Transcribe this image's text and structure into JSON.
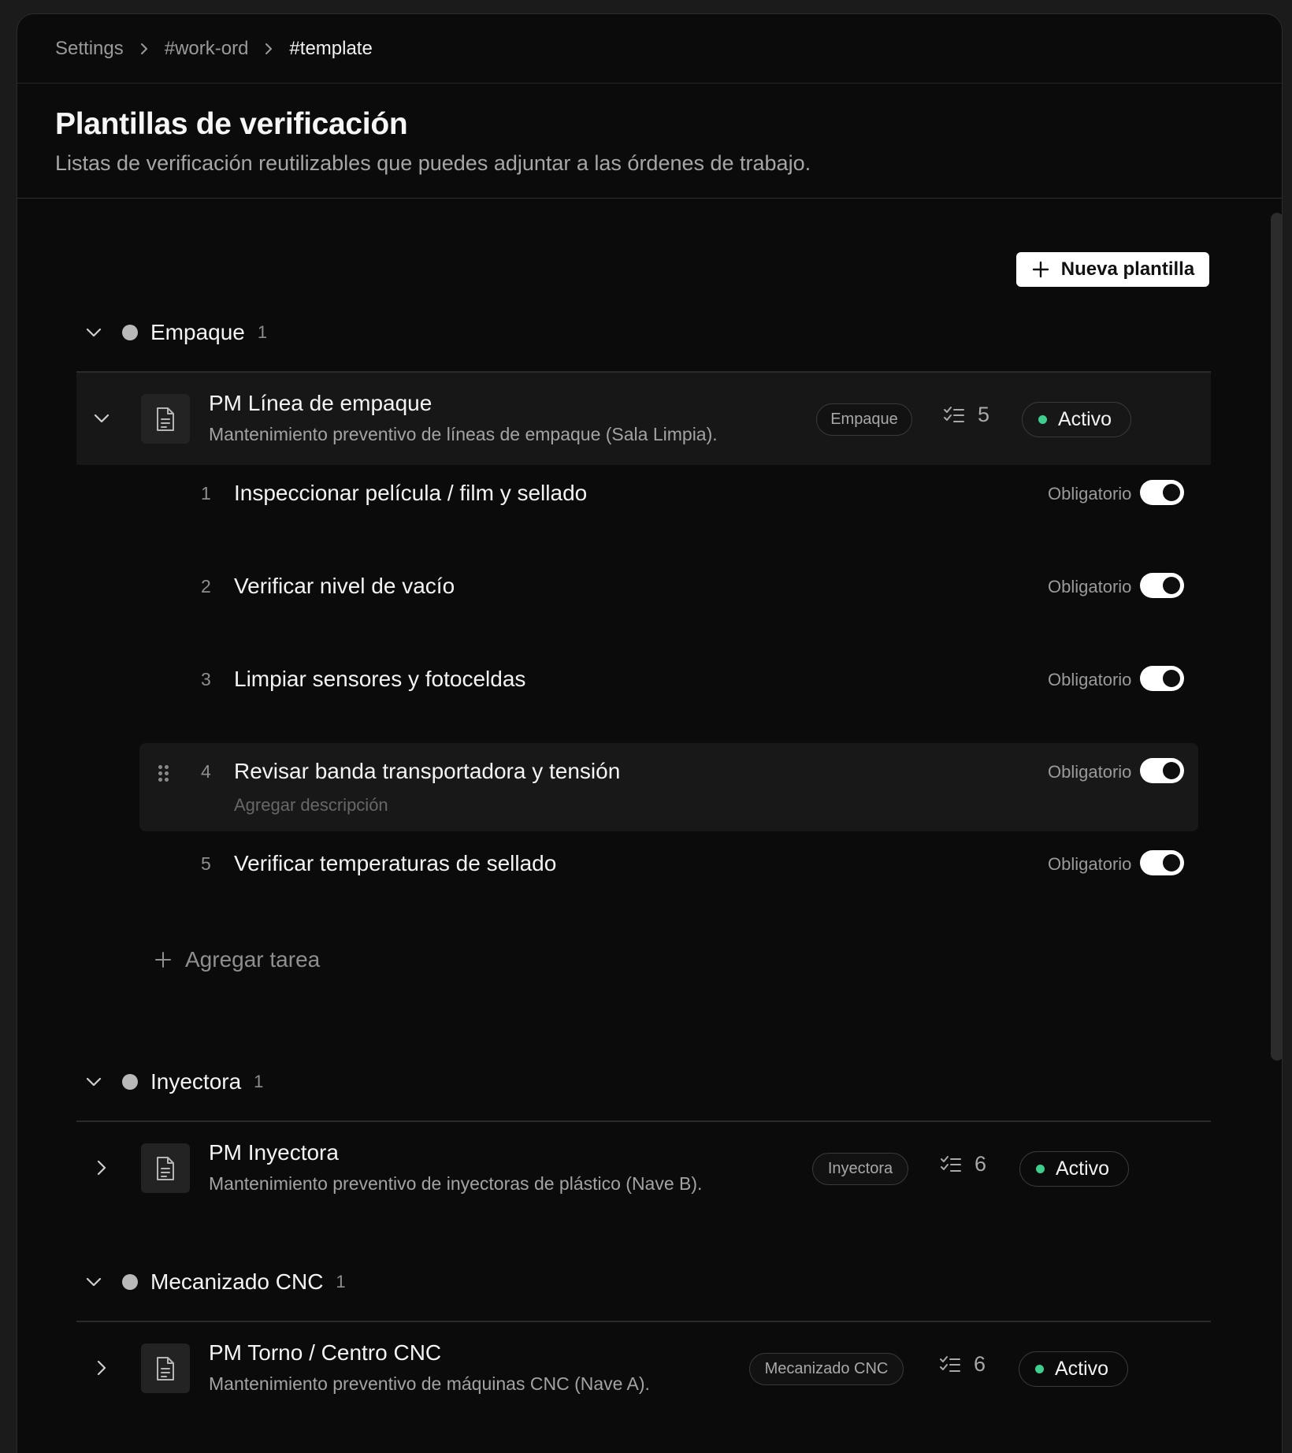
{
  "breadcrumb": [
    "Settings",
    "#work-ord",
    "#template"
  ],
  "page": {
    "title": "Plantillas de verificación",
    "subtitle": "Listas de verificación reutilizables que puedes adjuntar a las órdenes de trabajo."
  },
  "new_template_label": "Nueva plantilla",
  "accent_colors": {
    "status_active": "#3ecf8e",
    "toggle_on": "#ffffff"
  },
  "groups": [
    {
      "name": "Empaque",
      "count": "1",
      "templates": [
        {
          "name": "PM Línea de empaque",
          "description": "Mantenimiento preventivo de líneas de empaque (Sala Limpia).",
          "tag": "Empaque",
          "task_count": "5",
          "status": "Activo",
          "expanded": true,
          "tasks": [
            {
              "num": "1",
              "label": "Inspeccionar película / film y sellado",
              "required_label": "Obligatorio",
              "required": true
            },
            {
              "num": "2",
              "label": "Verificar nivel de vacío",
              "required_label": "Obligatorio",
              "required": true
            },
            {
              "num": "3",
              "label": "Limpiar sensores y fotoceldas",
              "required_label": "Obligatorio",
              "required": true
            },
            {
              "num": "4",
              "label": "Revisar banda transportadora y tensión",
              "description_placeholder": "Agregar descripción",
              "required_label": "Obligatorio",
              "required": true
            },
            {
              "num": "5",
              "label": "Verificar temperaturas de sellado",
              "required_label": "Obligatorio",
              "required": true
            }
          ],
          "add_task_label": "Agregar tarea"
        }
      ]
    },
    {
      "name": "Inyectora",
      "count": "1",
      "templates": [
        {
          "name": "PM Inyectora",
          "description": "Mantenimiento preventivo de inyectoras de plástico (Nave B).",
          "tag": "Inyectora",
          "task_count": "6",
          "status": "Activo",
          "expanded": false
        }
      ]
    },
    {
      "name": "Mecanizado CNC",
      "count": "1",
      "templates": [
        {
          "name": "PM Torno / Centro CNC",
          "description": "Mantenimiento preventivo de máquinas CNC (Nave A).",
          "tag": "Mecanizado CNC",
          "task_count": "6",
          "status": "Activo",
          "expanded": false
        }
      ]
    }
  ]
}
